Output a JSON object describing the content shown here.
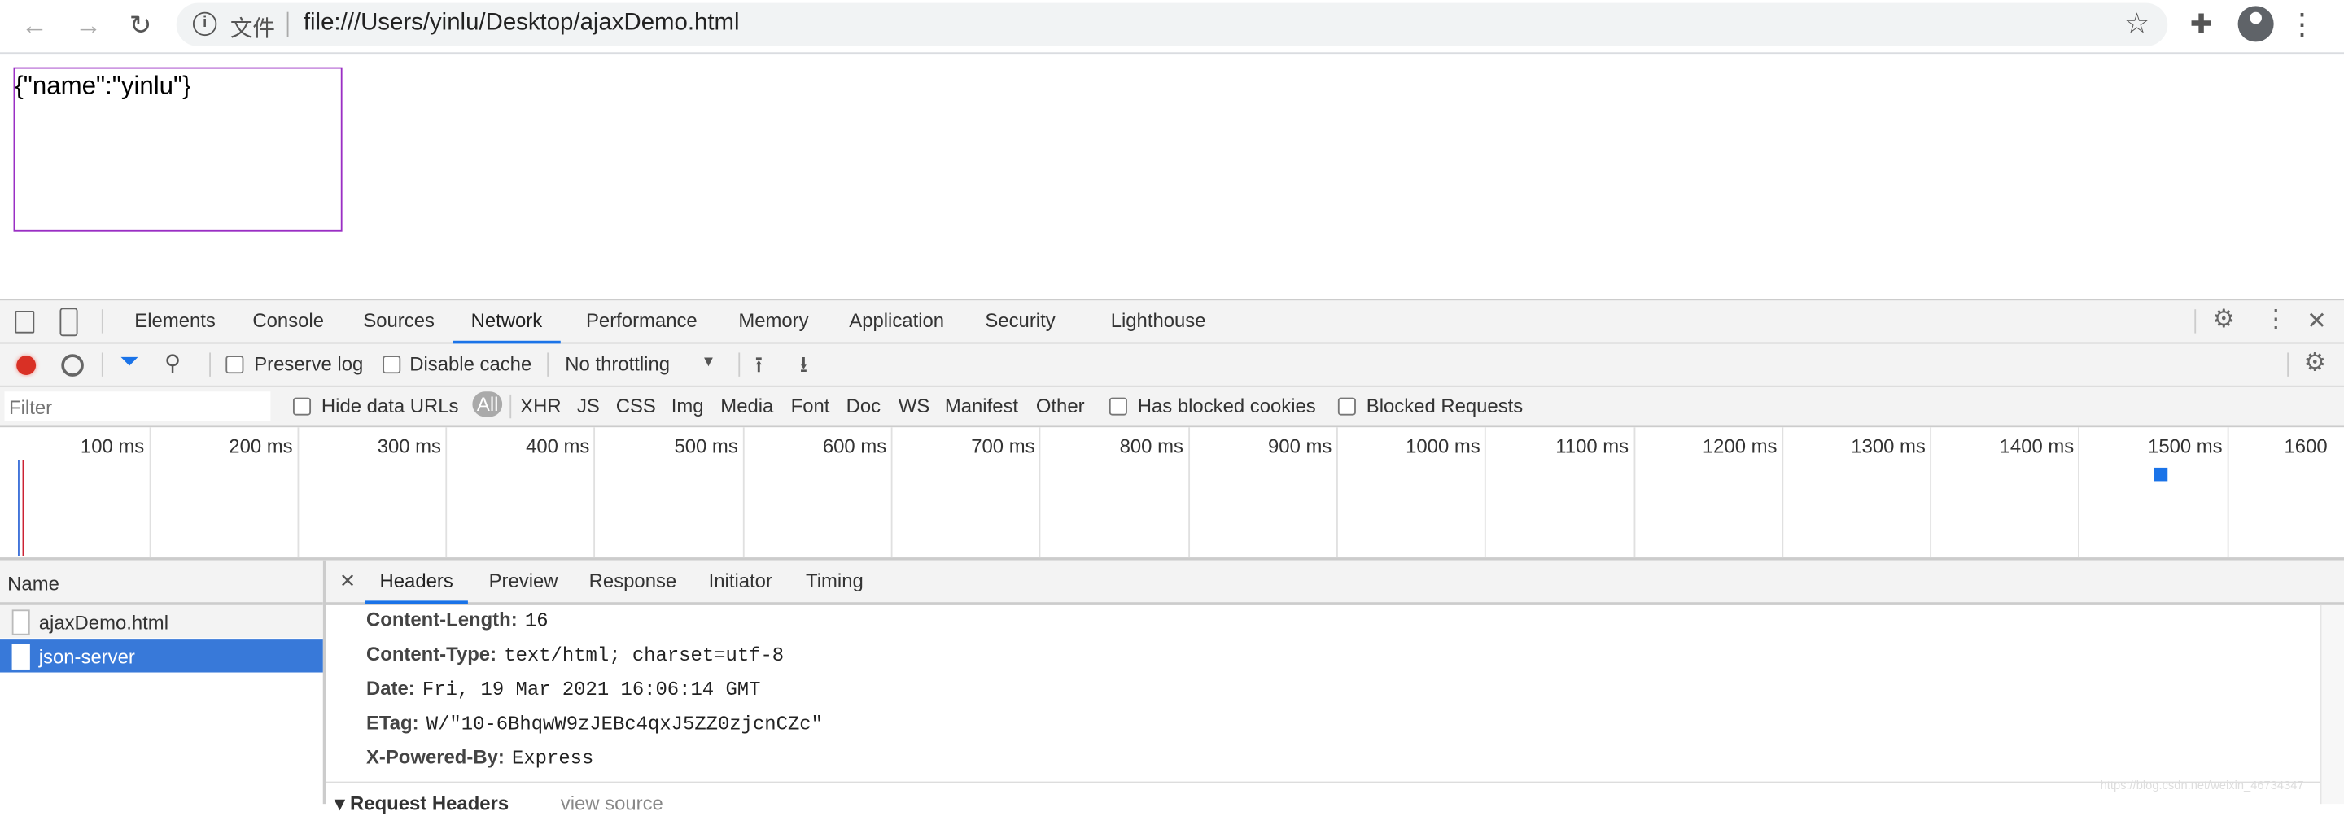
{
  "browser": {
    "scheme_label": "文件",
    "url": "file:///Users/yinlu/Desktop/ajaxDemo.html",
    "icons": [
      "back-icon",
      "forward-icon",
      "reload-icon",
      "info-icon",
      "star-icon",
      "extensions-icon",
      "profile-icon",
      "more-icon"
    ]
  },
  "page": {
    "content": "{\"name\":\"yinlu\"}",
    "box_border_color": "#9a2fc4"
  },
  "devtools": {
    "tabs": [
      "Elements",
      "Console",
      "Sources",
      "Network",
      "Performance",
      "Memory",
      "Application",
      "Security",
      "Lighthouse"
    ],
    "active_tab": "Network",
    "toolbar": {
      "preserve_log": "Preserve log",
      "disable_cache": "Disable cache",
      "throttling": "No throttling"
    },
    "filter": {
      "placeholder": "Filter",
      "hide_data_urls": "Hide data URLs",
      "types": [
        "All",
        "XHR",
        "JS",
        "CSS",
        "Img",
        "Media",
        "Font",
        "Doc",
        "WS",
        "Manifest",
        "Other"
      ],
      "active_type": "All",
      "has_blocked_cookies": "Has blocked cookies",
      "blocked_requests": "Blocked Requests"
    },
    "timeline": {
      "ticks": [
        "100 ms",
        "200 ms",
        "300 ms",
        "400 ms",
        "500 ms",
        "600 ms",
        "700 ms",
        "800 ms",
        "900 ms",
        "1000 ms",
        "1100 ms",
        "1200 ms",
        "1300 ms",
        "1400 ms",
        "1500 ms",
        "1600"
      ]
    },
    "requests": {
      "column": "Name",
      "items": [
        {
          "name": "ajaxDemo.html",
          "selected": false
        },
        {
          "name": "json-server",
          "selected": true
        }
      ]
    },
    "detail": {
      "tabs": [
        "Headers",
        "Preview",
        "Response",
        "Initiator",
        "Timing"
      ],
      "active_tab": "Headers",
      "headers": [
        {
          "name": "Content-Length:",
          "value": "16"
        },
        {
          "name": "Content-Type:",
          "value": "text/html; charset=utf-8"
        },
        {
          "name": "Date:",
          "value": "Fri, 19 Mar 2021 16:06:14 GMT"
        },
        {
          "name": "ETag:",
          "value": "W/\"10-6BhqwW9zJEBc4qxJ5ZZ0zjcnCZc\""
        },
        {
          "name": "X-Powered-By:",
          "value": "Express"
        }
      ],
      "section": "▾ Request Headers",
      "view_source": "view source"
    },
    "accent": "#1a73e8",
    "selected_row_color": "#3879d9"
  },
  "watermark": "https://blog.csdn.net/weixin_46734347"
}
